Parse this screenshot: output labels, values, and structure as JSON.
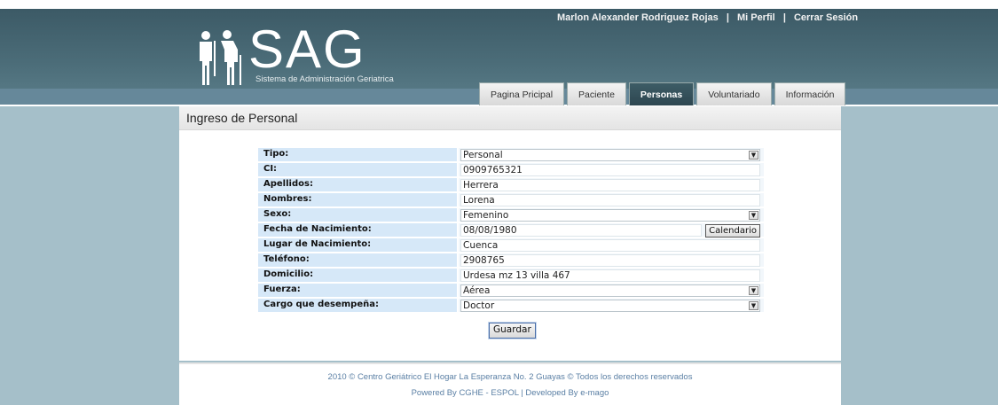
{
  "header": {
    "user_name": "Marlon Alexander Rodriguez Rojas",
    "profile_link": "Mi Perfil",
    "logout_link": "Cerrar Sesión",
    "separator": "|",
    "logo_text": "SAG",
    "logo_subtitle": "Sistema de Administración Geriatrica",
    "logo_icon": "elderly-people-icon"
  },
  "tabs": [
    {
      "label": "Pagina Pricipal",
      "active": false
    },
    {
      "label": "Paciente",
      "active": false
    },
    {
      "label": "Personas",
      "active": true
    },
    {
      "label": "Voluntariado",
      "active": false
    },
    {
      "label": "Información",
      "active": false
    }
  ],
  "panel": {
    "title": "Ingreso de Personal"
  },
  "form": {
    "tipo": {
      "label": "Tipo:",
      "value": "Personal"
    },
    "ci": {
      "label": "CI:",
      "value": "0909765321"
    },
    "apellidos": {
      "label": "Apellidos:",
      "value": "Herrera"
    },
    "nombres": {
      "label": "Nombres:",
      "value": "Lorena"
    },
    "sexo": {
      "label": "Sexo:",
      "value": "Femenino"
    },
    "fecha": {
      "label": "Fecha de Nacimiento:",
      "value": "08/08/1980",
      "button": "Calendario"
    },
    "lugar": {
      "label": "Lugar de Nacimiento:",
      "value": "Cuenca"
    },
    "telefono": {
      "label": "Teléfono:",
      "value": "2908765"
    },
    "domicilio": {
      "label": "Domicilio:",
      "value": "Urdesa mz 13 villa 467"
    },
    "fuerza": {
      "label": "Fuerza:",
      "value": "Aérea"
    },
    "cargo": {
      "label": "Cargo que desempeña:",
      "value": "Doctor"
    },
    "save_label": "Guardar"
  },
  "footer": {
    "line1": "2010 © Centro Geriátrico El Hogar La Esperanza No. 2 Guayas © Todos los derechos reservados",
    "line2": "Powered By CGHE - ESPOL | Developed By e-mago"
  },
  "colors": {
    "header_bg": "#4b6c78",
    "page_bg": "#a5bfc9",
    "label_bg": "#d6e8f8",
    "active_tab": "#2d4650",
    "footer_text": "#5a7fa4"
  }
}
